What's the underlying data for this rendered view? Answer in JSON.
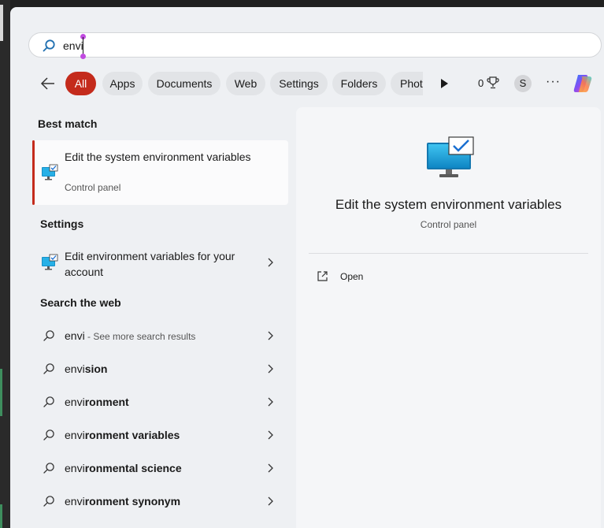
{
  "search": {
    "query": "envi"
  },
  "filters": {
    "chips": [
      {
        "label": "All",
        "active": true
      },
      {
        "label": "Apps"
      },
      {
        "label": "Documents"
      },
      {
        "label": "Web"
      },
      {
        "label": "Settings"
      },
      {
        "label": "Folders"
      },
      {
        "label": "Photo"
      }
    ],
    "points": "0",
    "avatar_initial": "S",
    "more_label": "···"
  },
  "best_match": {
    "heading": "Best match",
    "title": "Edit the system environment variables",
    "subtitle": "Control panel"
  },
  "settings": {
    "heading": "Settings",
    "items": [
      {
        "title": "Edit environment variables for your account"
      }
    ]
  },
  "web": {
    "heading": "Search the web",
    "items": [
      {
        "prefix": "envi",
        "suffix": "",
        "sub": " - See more search results"
      },
      {
        "prefix": "envi",
        "suffix": "sion",
        "sub": ""
      },
      {
        "prefix": "envi",
        "suffix": "ronment",
        "sub": ""
      },
      {
        "prefix": "envi",
        "suffix": "ronment variables",
        "sub": ""
      },
      {
        "prefix": "envi",
        "suffix": "ronmental science",
        "sub": ""
      },
      {
        "prefix": "envi",
        "suffix": "ronment synonym",
        "sub": ""
      }
    ]
  },
  "preview": {
    "title": "Edit the system environment variables",
    "subtitle": "Control panel",
    "actions": [
      {
        "label": "Open"
      }
    ]
  },
  "colors": {
    "accent": "#c42b1c",
    "panel": "#eef0f3",
    "preview": "#f5f6f8"
  },
  "icons": {
    "search": "search-icon",
    "back": "back-arrow-icon",
    "play": "play-icon",
    "trophy": "trophy-icon",
    "copilot": "copilot-icon",
    "control_panel": "control-panel-icon",
    "chevron": "chevron-right-icon",
    "open": "open-external-icon"
  }
}
